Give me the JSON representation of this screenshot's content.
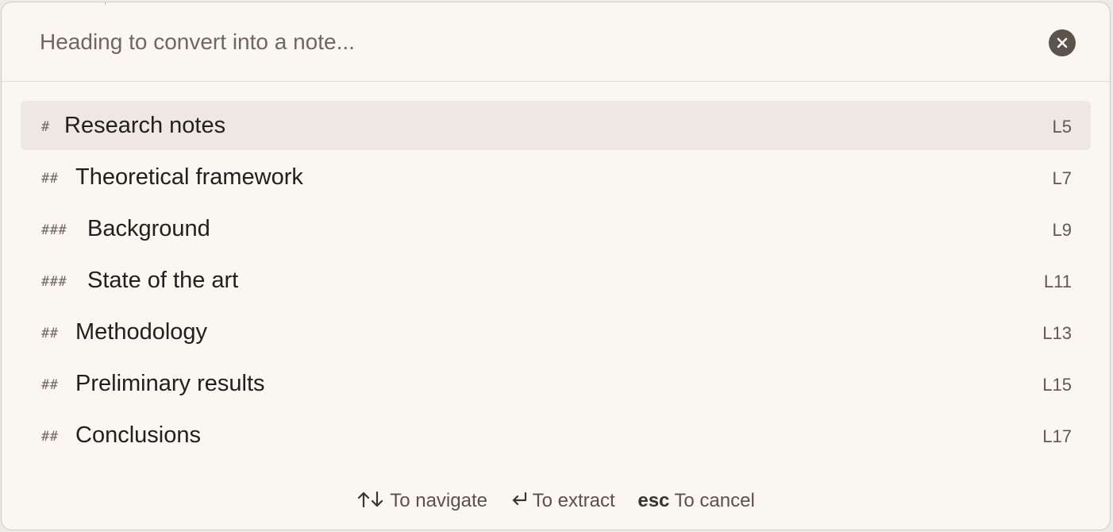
{
  "prompt": {
    "placeholder": "Heading to convert into a note...",
    "value": ""
  },
  "close_icon": "close-icon",
  "results": [
    {
      "hashes": "#",
      "level": 1,
      "title": "Research notes",
      "line": "L5",
      "selected": true
    },
    {
      "hashes": "##",
      "level": 2,
      "title": "Theoretical framework",
      "line": "L7",
      "selected": false
    },
    {
      "hashes": "###",
      "level": 3,
      "title": "Background",
      "line": "L9",
      "selected": false
    },
    {
      "hashes": "###",
      "level": 3,
      "title": "State of the art",
      "line": "L11",
      "selected": false
    },
    {
      "hashes": "##",
      "level": 2,
      "title": "Methodology",
      "line": "L13",
      "selected": false
    },
    {
      "hashes": "##",
      "level": 2,
      "title": "Preliminary results",
      "line": "L15",
      "selected": false
    },
    {
      "hashes": "##",
      "level": 2,
      "title": "Conclusions",
      "line": "L17",
      "selected": false
    }
  ],
  "footer": {
    "navigate": {
      "icon": "up-down-arrows-icon",
      "label": "To navigate"
    },
    "extract": {
      "icon": "enter-key-icon",
      "label": "To extract"
    },
    "cancel": {
      "key": "esc",
      "label": "To cancel"
    }
  },
  "colors": {
    "background": "#faf7f2",
    "selected_row": "#efe7e1",
    "close_button": "#5a544d",
    "text_primary": "#22201d",
    "text_muted": "#6e6861"
  }
}
